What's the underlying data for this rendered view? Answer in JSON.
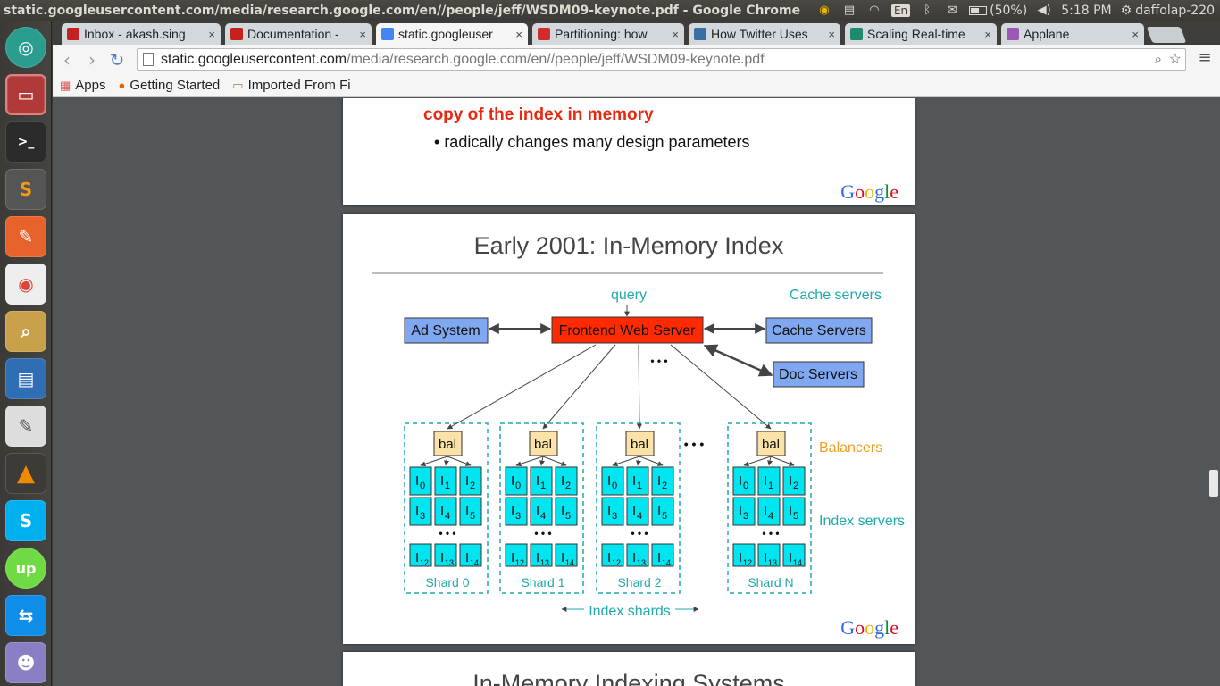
{
  "topbar": {
    "window_title": "static.googleusercontent.com/media/research.google.com/en//people/jeff/WSDM09-keynote.pdf - Google Chrome",
    "keyboard": "En",
    "battery": "(50%)",
    "time": "5:18 PM",
    "user": "daffolap-220"
  },
  "tabs": [
    {
      "label": "Inbox - akash.sing",
      "favicon": "gmail-icon",
      "color": "#c5221f"
    },
    {
      "label": "Documentation -",
      "favicon": "gmail-icon",
      "color": "#c5221f"
    },
    {
      "label": "static.googleuser",
      "favicon": "google-icon",
      "color": "#4285f4"
    },
    {
      "label": "Partitioning: how",
      "favicon": "redis-icon",
      "color": "#d22b2b"
    },
    {
      "label": "How Twitter Uses",
      "favicon": "stackexchange-icon",
      "color": "#3a6ea5"
    },
    {
      "label": "Scaling Real-time",
      "favicon": "p-icon",
      "color": "#1f8a70"
    },
    {
      "label": "Applane",
      "favicon": "puzzle-icon",
      "color": "#9b59b6"
    }
  ],
  "address": {
    "host": "static.googleusercontent.com",
    "path": "/media/research.google.com/en//people/jeff/WSDM09-keynote.pdf"
  },
  "bookmarks": [
    {
      "label": "Apps",
      "icon": "apps-grid-icon"
    },
    {
      "label": "Getting Started",
      "icon": "firefox-icon"
    },
    {
      "label": "Imported From Fi",
      "icon": "folder-icon"
    }
  ],
  "slide_prev": {
    "line1": "copy of the index in memory",
    "bullet": "radically changes many design parameters",
    "logo": "Google"
  },
  "slide_main": {
    "title": "Early 2001: In-Memory Index",
    "query": "query",
    "cache_caption": "Cache servers",
    "frontend": "Frontend Web Server",
    "ad_system": "Ad System",
    "cache_servers": "Cache Servers",
    "doc_servers": "Doc Servers",
    "ellipsis": "• • •",
    "balancers_caption": "Balancers",
    "index_servers_caption": "Index servers",
    "index_shards_caption": "Index shards",
    "bal": "bal",
    "shards": [
      "Shard 0",
      "Shard 1",
      "Shard 2",
      "Shard N"
    ],
    "index_base": "I",
    "index_subs": [
      "0",
      "1",
      "2",
      "3",
      "4",
      "5",
      "12",
      "13",
      "14"
    ],
    "logo": "Google"
  },
  "slide_next": {
    "title": "In-Memory Indexing Systems"
  },
  "colors": {
    "accent_red": "#e8280f",
    "frontend_fill": "#ff2a00",
    "server_fill": "#7fa8f0",
    "bal_fill": "#fbe3a8",
    "index_fill": "#00e5f0",
    "teal_text": "#20aaaa",
    "orange_text": "#f0a020"
  }
}
